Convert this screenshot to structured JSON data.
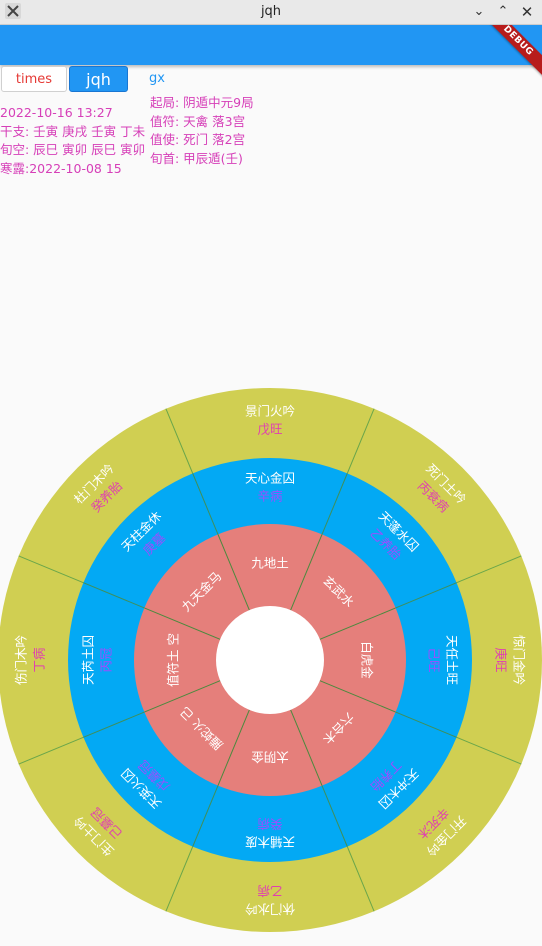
{
  "window": {
    "title": "jqh"
  },
  "appbar": {
    "debug_label": "DEBUG"
  },
  "tabs": [
    {
      "label": "times"
    },
    {
      "label": "jqh"
    },
    {
      "label": "gx"
    }
  ],
  "info_left": [
    "2022-10-16 13:27",
    "干支: 壬寅 庚戌 壬寅 丁未",
    "旬空: 辰巳 寅卯 辰巳 寅卯",
    "寒露:2022-10-08 15"
  ],
  "info_right": [
    "起局: 阴遁中元9局",
    "值符: 天禽 落3宫",
    "值使: 死门 落2宫",
    "旬首: 甲辰遁(壬)"
  ],
  "colors": {
    "outer_ring": "#d0cf52",
    "middle_ring": "#03a9f4",
    "inner_ring": "#e57f7b",
    "label_white": "#ffffff",
    "label_pink": "#e040b0",
    "label_purple": "#9c4dff"
  },
  "outer": [
    {
      "main": "景门火吟",
      "sub": "戊旺"
    },
    {
      "main": "死门土吟",
      "sub": "丙衰病"
    },
    {
      "main": "惊门金吟",
      "sub": "庚旺"
    },
    {
      "main": "开门金吟",
      "sub": "辛死沐"
    },
    {
      "main": "休门水吟",
      "sub": "乙病"
    },
    {
      "main": "生门土吟",
      "sub": "己墓冠"
    },
    {
      "main": "伤门木吟",
      "sub": "丁病"
    },
    {
      "main": "杜门木吟",
      "sub": "癸养胎"
    }
  ],
  "middle": [
    {
      "main": "天心金囚",
      "sub": "辛病"
    },
    {
      "main": "天蓬水囚",
      "sub": "乙养胎"
    },
    {
      "main": "天任土旺",
      "sub": "己旺"
    },
    {
      "main": "天冲木囚",
      "sub": "丁养胎"
    },
    {
      "main": "天辅木废",
      "sub": "癸病"
    },
    {
      "main": "天英火囚",
      "sub": "戊墓冠"
    },
    {
      "main": "天芮土囚",
      "sub": "丙冠"
    },
    {
      "main": "天柱金休",
      "sub": "庚墓"
    }
  ],
  "inner": [
    "九地土",
    "玄武水",
    "白虎金",
    "六合木",
    "太阴金",
    "螣蛇火 己",
    "值符土 空",
    "九天金马"
  ]
}
